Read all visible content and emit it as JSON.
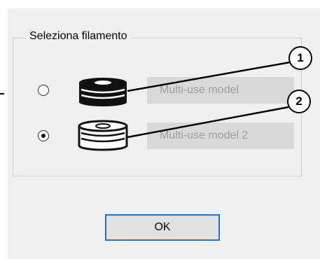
{
  "group": {
    "legend": "Seleziona filamento"
  },
  "options": [
    {
      "label": "Multi-use model",
      "selected": false,
      "spool_icon": "spool-filled-icon"
    },
    {
      "label": "Multi-use model 2",
      "selected": true,
      "spool_icon": "spool-outline-icon"
    }
  ],
  "buttons": {
    "ok_label": "OK"
  },
  "callouts": [
    {
      "number": "1"
    },
    {
      "number": "2"
    }
  ],
  "colors": {
    "dialog_bg": "#f0f0f0",
    "ok_border": "#2f6fb3",
    "label_bg": "#d9d9d9",
    "label_text": "#9e9e9e"
  }
}
